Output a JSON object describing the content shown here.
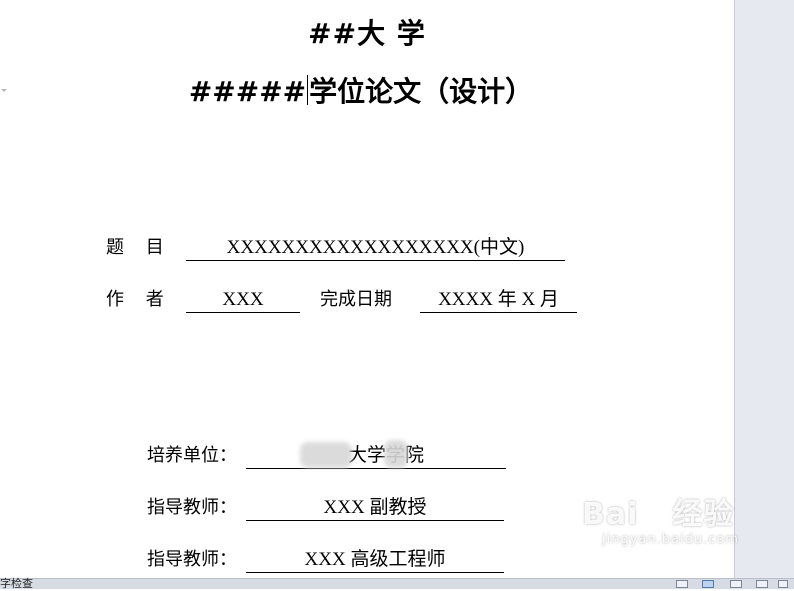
{
  "document": {
    "university_title": "##大 学",
    "thesis_title_prefix": "#####",
    "thesis_title_rest": "学位论文（设计）",
    "fields": {
      "topic_label": "题 目",
      "topic_value": "XXXXXXXXXXXXXXXXXX(中文)",
      "author_label": "作 者",
      "author_value": "XXX",
      "date_label": "完成日期",
      "date_value": "XXXX 年 X 月",
      "unit_label": "培养单位：",
      "unit_value": "大学学院",
      "advisor1_label": "指导教师：",
      "advisor1_value": "XXX 副教授",
      "advisor2_label": "指导教师：",
      "advisor2_value": "XXX 高级工程师"
    }
  },
  "watermark": {
    "brand": "Bai",
    "brand_cn": "经验",
    "site": "jingyan.baidu.com"
  },
  "statusbar": {
    "text": "字检查"
  }
}
